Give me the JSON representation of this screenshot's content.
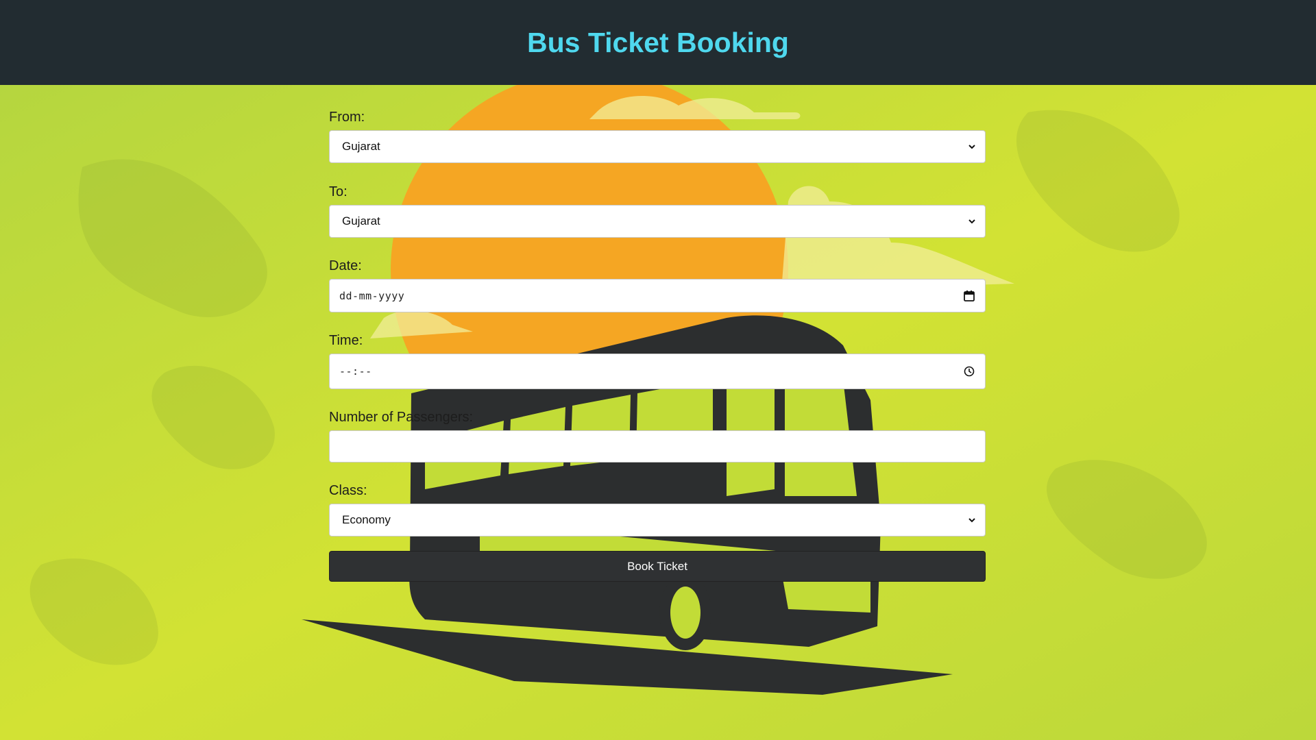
{
  "header": {
    "title": "Bus Ticket Booking"
  },
  "form": {
    "from": {
      "label": "From:",
      "value": "Gujarat"
    },
    "to": {
      "label": "To:",
      "value": "Gujarat"
    },
    "date": {
      "label": "Date:",
      "placeholder": "dd-mm-yyyy"
    },
    "time": {
      "label": "Time:",
      "placeholder": "--:--"
    },
    "passengers": {
      "label": "Number of Passengers:",
      "value": ""
    },
    "class": {
      "label": "Class:",
      "value": "Economy"
    },
    "submit_label": "Book Ticket"
  },
  "icons": {
    "select_arrow": "chevron-down-icon",
    "date_picker": "calendar-icon",
    "time_picker": "clock-icon"
  },
  "colors": {
    "header_bg": "#222c31",
    "title": "#4fd8ee",
    "background": "#c6de3a",
    "sun": "#f5a623",
    "bus": "#2c2e2f",
    "button_bg": "#2f3133"
  }
}
